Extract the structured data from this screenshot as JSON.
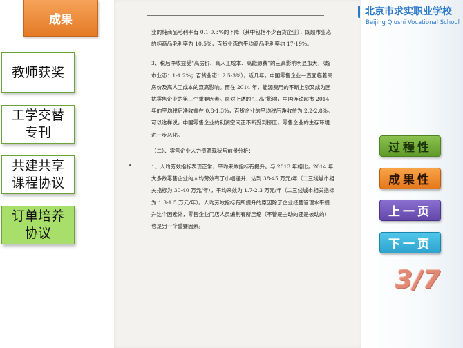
{
  "header": {
    "tab_title": "成果"
  },
  "left_nav": {
    "items": [
      {
        "label": "教师获奖"
      },
      {
        "label": "工学交替\n专刊"
      },
      {
        "label": "共建共享\n课程协议"
      },
      {
        "label": "订单培养\n协议",
        "active": true
      }
    ]
  },
  "school": {
    "name_cn": "北京市求实职业学校",
    "name_en": "Beijing Qiushi Vocational School",
    "brand_color": "#2a78c8"
  },
  "document": {
    "paragraphs": [
      "业的纯商品毛利率有 0.1-0.3%的下降（其中包括不少百货企业），既超市业态的纯商品毛利率为 10.5%，百货业态的平均商品毛利率约 17-19%。",
      "3、税后净收益受“高房价、高人工成本、高能源费”的三高影响明显加大，（超市业态：1-1.2%；百货业态：2.5-3%），近几年，中国零售企业一直面临着高房价及高人工成本的双高影响。而在 2014 年，能源费用的不断上涨又成为困扰零售企业的第三个重要因素。面对上述的“三高”影响，中国连锁超市 2014 年的平均税后净收益在 0.8-1.3%，百货企业的平均税后净收益为 2.2-2.8%。可以这样说，中国零售企业的利润空间正不断受到挤压，零售企业的生存环境进一步恶化。",
      "（二）、零售企业人力资源现状与前景分析：",
      "1、人均劳效指标表现正常，平均来效指标有提升。与 2013 年相比，2014 年大多数零售企业的人均劳效有了小幅提升，达到 38-45 万元/年（二三线城市相关指标为 30-40 万元/年），平均来效为 1.7-2.3 万元/年（二三线城市相关指标为 1.3-1.5 万元/年）。人均劳效指标有所提升的原因除了企业经营管理水平提升这个因素外，零售企业门店人员编制有所压缩（不管是主动的还是被动的）也是另一个重要因素。"
    ]
  },
  "right_nav": {
    "process_label": "过程性",
    "result_label": "成果性",
    "prev_label": "上一页",
    "next_label": "下一页"
  },
  "pager": {
    "page_indicator": "3/7"
  }
}
